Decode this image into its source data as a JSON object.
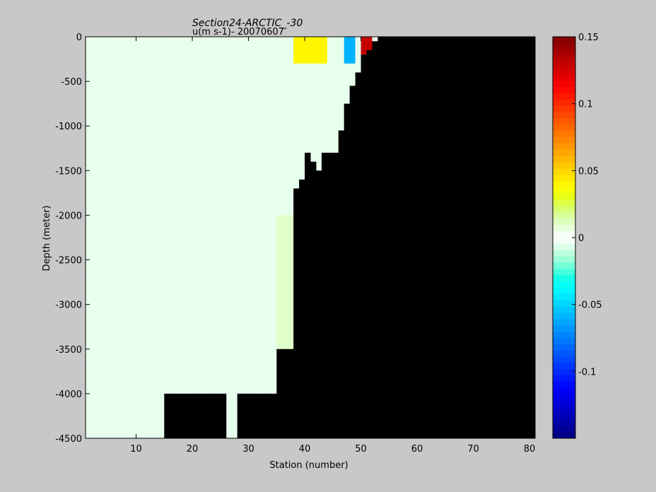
{
  "chart_data": {
    "type": "heatmap",
    "title": "Section24-ARCTIC_-30",
    "subtitle": "u(m s-1)- 20070607",
    "xlabel": "Station (number)",
    "ylabel": "Depth (meter)",
    "xlim": [
      1,
      81
    ],
    "ylim": [
      -4500,
      0
    ],
    "xticks": [
      10,
      20,
      30,
      40,
      50,
      60,
      70,
      80
    ],
    "yticks": [
      0,
      -500,
      -1000,
      -1500,
      -2000,
      -2500,
      -3000,
      -3500,
      -4000,
      -4500
    ],
    "colorbar": {
      "range": [
        -0.15,
        0.15
      ],
      "ticks": [
        0.15,
        0.1,
        0.05,
        0,
        -0.05,
        -0.1
      ],
      "colormap": "jet"
    },
    "land_color": "#000000",
    "bathymetry_bottom_depth_by_station": [
      [
        1,
        -4500
      ],
      [
        14,
        -4500
      ],
      [
        15,
        -4000
      ],
      [
        25,
        -4000
      ],
      [
        26,
        -4500
      ],
      [
        27,
        -4500
      ],
      [
        28,
        -4000
      ],
      [
        34,
        -4000
      ],
      [
        35,
        -3500
      ],
      [
        37,
        -3500
      ],
      [
        38,
        -1700
      ],
      [
        39,
        -1600
      ],
      [
        40,
        -1300
      ],
      [
        41,
        -1400
      ],
      [
        42,
        -1500
      ],
      [
        43,
        -1300
      ],
      [
        45,
        -1300
      ],
      [
        46,
        -1050
      ],
      [
        47,
        -750
      ],
      [
        48,
        -550
      ],
      [
        49,
        -400
      ],
      [
        50,
        -200
      ],
      [
        51,
        -150
      ],
      [
        52,
        -50
      ],
      [
        53,
        0
      ]
    ],
    "velocity_features": [
      {
        "station_range": [
          38,
          44
        ],
        "depth_range": [
          0,
          -300
        ],
        "value": 0.04
      },
      {
        "station_range": [
          47,
          49
        ],
        "depth_range": [
          0,
          -300
        ],
        "value": -0.06
      },
      {
        "station_range": [
          50,
          52
        ],
        "depth_range": [
          0,
          -150
        ],
        "value": 0.13
      },
      {
        "station_range": [
          35,
          38
        ],
        "depth_range": [
          -2000,
          -3500
        ],
        "value": 0.01
      },
      {
        "station_range": [
          1,
          37
        ],
        "depth_range": [
          0,
          -4500
        ],
        "value": -0.005
      }
    ]
  }
}
